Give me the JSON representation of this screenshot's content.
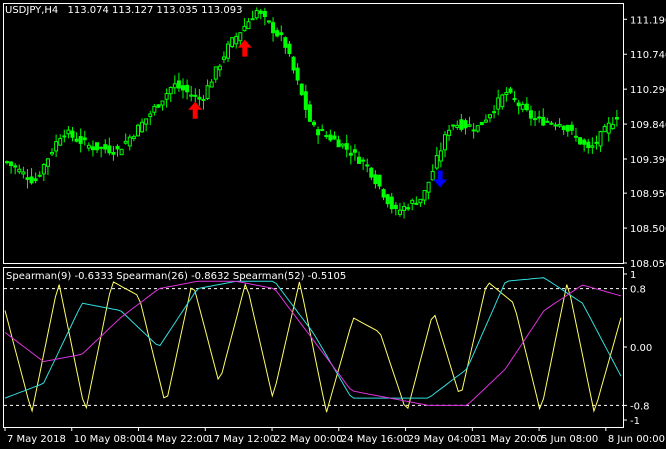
{
  "window": {
    "symbol_tf": "USDJPY,H4",
    "ohlc": "113.074 113.127 113.035 113.093"
  },
  "indicator": {
    "title": "Spearman(9) -0.6333  Spearman(26) -0.8632  Spearman(52) -0.5105"
  },
  "colors": {
    "background": "#000000",
    "frame": "#ffffff",
    "bull_candle": "#00ff00",
    "arrow_up": "#ff0000",
    "arrow_down": "#0000ff",
    "spearman_fast": "#ffff66",
    "spearman_mid": "#33dddd",
    "spearman_slow": "#dd33dd",
    "level_lines": "#ffffff"
  },
  "chart_data": [
    {
      "type": "candlestick",
      "title": "USDJPY,H4  113.074 113.127 113.035 113.093",
      "y_ticks": [
        "111.190",
        "110.740",
        "110.290",
        "109.840",
        "109.390",
        "108.950",
        "108.500",
        "108.050"
      ],
      "ylim": [
        108.05,
        111.4
      ],
      "x_ticks": [
        "7 May 2018",
        "10 May 08:00",
        "14 May 22:00",
        "17 May 12:00",
        "22 May 00:00",
        "24 May 16:00",
        "29 May 04:00",
        "31 May 20:00",
        "5 Jun 08:00",
        "8 Jun 00:00"
      ],
      "price_path": [
        109.35,
        109.1,
        109.75,
        109.55,
        109.5,
        109.9,
        110.35,
        110.15,
        110.85,
        111.3,
        110.9,
        109.8,
        109.6,
        109.3,
        108.7,
        108.9,
        109.85,
        109.8,
        110.25,
        109.9,
        109.85,
        109.5,
        109.95
      ],
      "signals": [
        {
          "direction": "up",
          "price": 110.05
        },
        {
          "direction": "up",
          "price": 110.85
        },
        {
          "direction": "down",
          "price": 109.1
        }
      ]
    },
    {
      "type": "line",
      "title": "Spearman(9) -0.6333  Spearman(26) -0.8632  Spearman(52) -0.5105",
      "y_ticks": [
        "1",
        "0.8",
        "0.00",
        "-0.8",
        "-1"
      ],
      "ylim": [
        -1,
        1
      ],
      "levels": [
        0.8,
        -0.8
      ],
      "series": [
        {
          "name": "Spearman(9)",
          "last": -0.6333,
          "values": [
            0.5,
            -0.9,
            0.9,
            -0.9,
            0.9,
            0.7,
            -0.8,
            0.9,
            -0.5,
            0.9,
            -0.7,
            0.9,
            -0.9,
            0.4,
            0.2,
            -0.9,
            0.5,
            -0.7,
            0.9,
            0.6,
            -0.9,
            0.9,
            -0.9,
            0.4
          ]
        },
        {
          "name": "Spearman(26)",
          "last": -0.8632,
          "values": [
            -0.7,
            -0.5,
            0.6,
            0.5,
            0.0,
            0.8,
            0.9,
            0.9,
            0.2,
            -0.7,
            -0.7,
            -0.7,
            -0.3,
            0.9,
            0.95,
            0.6,
            -0.4
          ]
        },
        {
          "name": "Spearman(52)",
          "last": -0.5105,
          "values": [
            0.2,
            -0.2,
            -0.1,
            0.4,
            0.8,
            0.9,
            0.9,
            0.8,
            0.1,
            -0.6,
            -0.7,
            -0.8,
            -0.8,
            -0.3,
            0.5,
            0.85,
            0.7
          ]
        }
      ]
    }
  ]
}
